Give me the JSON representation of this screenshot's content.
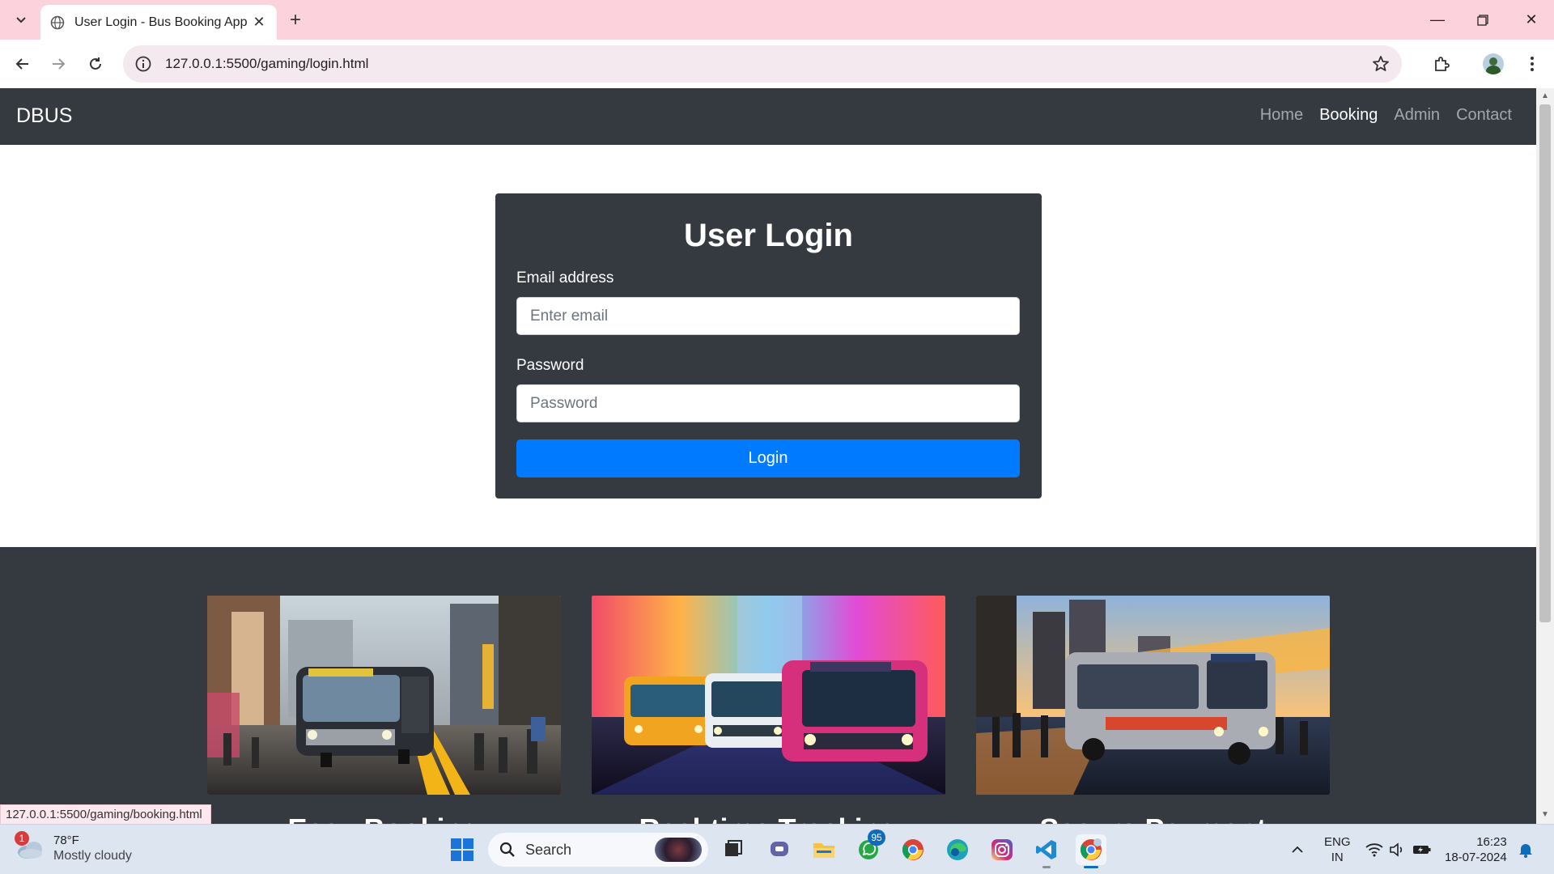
{
  "browser": {
    "tab_title": "User Login - Bus Booking App",
    "url": "127.0.0.1:5500/gaming/login.html",
    "status_url": "127.0.0.1:5500/gaming/booking.html"
  },
  "navbar": {
    "brand": "DBUS",
    "links": [
      {
        "label": "Home",
        "active": false
      },
      {
        "label": "Booking",
        "active": true
      },
      {
        "label": "Admin",
        "active": false
      },
      {
        "label": "Contact",
        "active": false
      }
    ]
  },
  "login": {
    "title": "User Login",
    "email_label": "Email address",
    "email_placeholder": "Enter email",
    "email_value": "",
    "password_label": "Password",
    "password_placeholder": "Password",
    "password_value": "",
    "submit_label": "Login"
  },
  "features": [
    {
      "caption": "Easy Booking"
    },
    {
      "caption": "Real-time Tracking"
    },
    {
      "caption": "Secure Payment"
    }
  ],
  "taskbar": {
    "weather_temp": "78°F",
    "weather_condition": "Mostly cloudy",
    "weather_badge": "1",
    "search_label": "Search",
    "whatsapp_badge": "95",
    "lang_line1": "ENG",
    "lang_line2": "IN",
    "time": "16:23",
    "date": "18-07-2024"
  },
  "colors": {
    "navbar_bg": "#343a40",
    "primary": "#007bff",
    "tabstrip": "#fcd3dc"
  }
}
